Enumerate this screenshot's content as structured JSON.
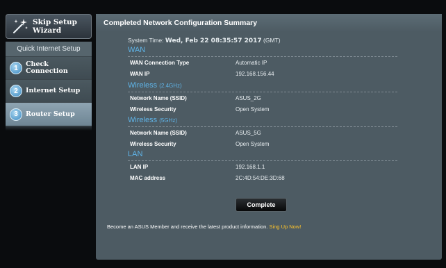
{
  "sidebar": {
    "wizard_label": "Skip Setup Wizard",
    "title": "Quick Internet Setup",
    "steps": [
      {
        "num": "1",
        "label_line1": "Check",
        "label_line2": "Connection"
      },
      {
        "num": "2",
        "label_line1": "Internet Setup",
        "label_line2": ""
      },
      {
        "num": "3",
        "label_line1": "Router Setup",
        "label_line2": ""
      }
    ],
    "active_step": 3
  },
  "panel": {
    "title": "Completed Network Configuration Summary",
    "system_time_label": "System Time:",
    "system_time_value": "Wed, Feb 22 08:35:57 2017",
    "system_time_zone": "(GMT)",
    "sections": {
      "wan": {
        "heading": "WAN",
        "rows": [
          {
            "key": "WAN Connection Type",
            "value": "Automatic IP"
          },
          {
            "key": "WAN IP",
            "value": "192.168.156.44"
          }
        ]
      },
      "wireless24": {
        "heading": "Wireless",
        "band": "(2.4GHz)",
        "rows": [
          {
            "key": "Network Name (SSID)",
            "value": "ASUS_2G"
          },
          {
            "key": "Wireless Security",
            "value": "Open System"
          }
        ]
      },
      "wireless5": {
        "heading": "Wireless",
        "band": "(5GHz)",
        "rows": [
          {
            "key": "Network Name (SSID)",
            "value": "ASUS_5G"
          },
          {
            "key": "Wireless Security",
            "value": "Open System"
          }
        ]
      },
      "lan": {
        "heading": "LAN",
        "rows": [
          {
            "key": "LAN IP",
            "value": "192.168.1.1"
          },
          {
            "key": "MAC address",
            "value": "2C:4D:54:DE:3D:68"
          }
        ]
      }
    },
    "complete_label": "Complete",
    "footer_text": "Become an ASUS Member and receive the latest product information.",
    "footer_link": "Sing Up Now!"
  },
  "colors": {
    "accent_blue": "#5fb4e8",
    "panel_bg": "#4d5b63",
    "link_yellow": "#ffc42a"
  }
}
